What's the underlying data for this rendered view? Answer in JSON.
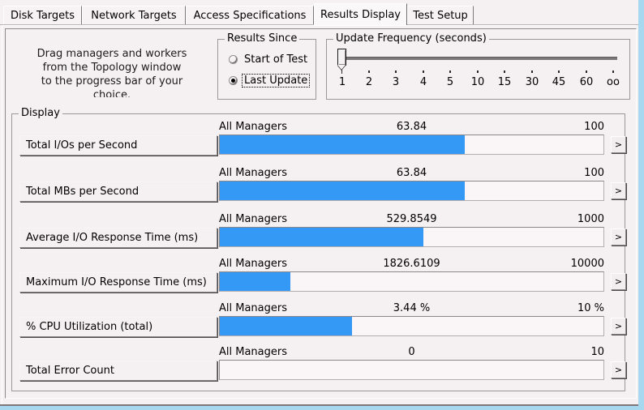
{
  "window": {
    "background_color": "#a8d8ef",
    "face_color": "#f5f0f2",
    "accent_color": "#3399f5"
  },
  "tabs": [
    {
      "label": "Disk Targets",
      "selected": false
    },
    {
      "label": "Network Targets",
      "selected": false
    },
    {
      "label": "Access Specifications",
      "selected": false
    },
    {
      "label": "Results Display",
      "selected": true
    },
    {
      "label": "Test Setup",
      "selected": false
    }
  ],
  "drag_hint": {
    "lines": [
      "Drag managers and workers",
      "from the Topology window",
      "to the progress bar of your",
      "choice."
    ]
  },
  "results_since": {
    "legend": "Results Since",
    "options": [
      {
        "label": "Start of Test",
        "selected": false,
        "focused": false
      },
      {
        "label": "Last Update",
        "selected": true,
        "focused": true
      }
    ]
  },
  "update_frequency": {
    "legend": "Update Frequency (seconds)",
    "ticks": [
      "1",
      "2",
      "3",
      "4",
      "5",
      "10",
      "15",
      "30",
      "45",
      "60",
      "oo"
    ],
    "selected_index": 0
  },
  "display": {
    "legend": "Display",
    "more_button_label": ">",
    "rows": [
      {
        "metric": "Total I/Os per Second",
        "source": "All Managers",
        "value": "63.84",
        "max": "100",
        "fill_percent": 63.8
      },
      {
        "metric": "Total MBs per Second",
        "source": "All Managers",
        "value": "63.84",
        "max": "100",
        "fill_percent": 63.8
      },
      {
        "metric": "Average I/O Response Time (ms)",
        "source": "All Managers",
        "value": "529.8549",
        "max": "1000",
        "fill_percent": 53.0
      },
      {
        "metric": "Maximum I/O Response Time (ms)",
        "source": "All Managers",
        "value": "1826.6109",
        "max": "10000",
        "fill_percent": 18.3
      },
      {
        "metric": "% CPU Utilization (total)",
        "source": "All Managers",
        "value": "3.44 %",
        "max": "10 %",
        "fill_percent": 34.4
      },
      {
        "metric": "Total Error Count",
        "source": "All Managers",
        "value": "0",
        "max": "10",
        "fill_percent": 0
      }
    ]
  }
}
